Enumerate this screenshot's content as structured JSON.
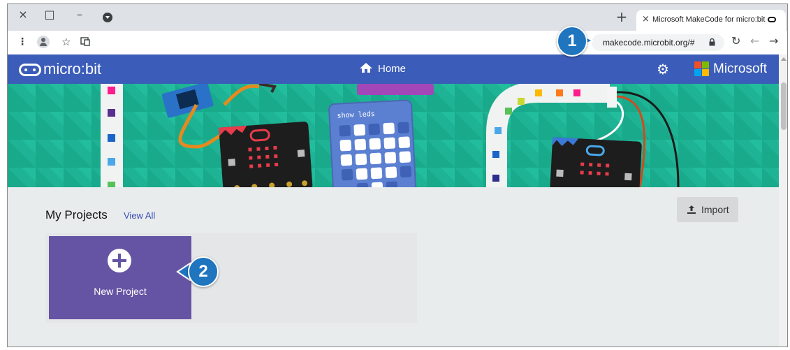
{
  "browser": {
    "tab_title": "Microsoft MakeCode for micro:bit",
    "url": "makecode.microbit.org/#",
    "new_tab": "+",
    "tab_close": "×",
    "win_close": "×",
    "win_max": "□",
    "win_min": "–"
  },
  "header": {
    "logo_text": "micro:bit",
    "home_label": "Home",
    "brand_text": "Microsoft",
    "brand_colors": [
      "#f25022",
      "#7fba00",
      "#00a4ef",
      "#ffb900"
    ]
  },
  "hero": {
    "block_label": "show leds",
    "background": "#1ab392"
  },
  "projects": {
    "title": "My Projects",
    "view_all": "View All",
    "import_label": "Import",
    "new_project_label": "New Project"
  },
  "callouts": {
    "one": "1",
    "two": "2"
  }
}
